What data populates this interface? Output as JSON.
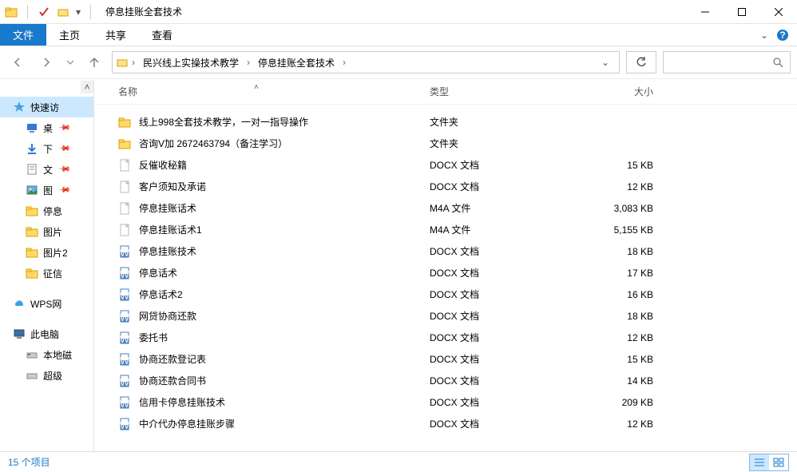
{
  "window": {
    "title": "停息挂账全套技术",
    "tabs": {
      "file": "文件",
      "home": "主页",
      "share": "共享",
      "view": "查看"
    }
  },
  "breadcrumb": {
    "segments": [
      "民兴线上实操技术教学",
      "停息挂账全套技术"
    ]
  },
  "columns": {
    "name": "名称",
    "type": "类型",
    "size": "大小"
  },
  "sidebar": {
    "quick": "快速访",
    "items": [
      {
        "label": "桌",
        "pinned": true,
        "icon": "desktop"
      },
      {
        "label": "下",
        "pinned": true,
        "icon": "download"
      },
      {
        "label": "文",
        "pinned": true,
        "icon": "document"
      },
      {
        "label": "图",
        "pinned": true,
        "icon": "picture"
      },
      {
        "label": "停息",
        "pinned": false,
        "icon": "folder"
      },
      {
        "label": "图片",
        "pinned": false,
        "icon": "folder"
      },
      {
        "label": "图片2",
        "pinned": false,
        "icon": "folder"
      },
      {
        "label": "征信",
        "pinned": false,
        "icon": "folder"
      }
    ],
    "wps": "WPS网",
    "thispc": "此电脑",
    "localdisk": "本地磁",
    "super": "超级"
  },
  "files": [
    {
      "name": "线上998全套技术教学，一对一指导操作",
      "type": "文件夹",
      "size": "",
      "icon": "folder"
    },
    {
      "name": "咨询V加  2672463794（备注学习）",
      "type": "文件夹",
      "size": "",
      "icon": "folder"
    },
    {
      "name": "反催收秘籍",
      "type": "DOCX 文档",
      "size": "15 KB",
      "icon": "docx-blank"
    },
    {
      "name": "客户须知及承诺",
      "type": "DOCX 文档",
      "size": "12 KB",
      "icon": "docx-blank"
    },
    {
      "name": "停息挂账话术",
      "type": "M4A 文件",
      "size": "3,083 KB",
      "icon": "blank"
    },
    {
      "name": "停息挂账话术1",
      "type": "M4A 文件",
      "size": "5,155 KB",
      "icon": "blank"
    },
    {
      "name": "停息挂账技术",
      "type": "DOCX 文档",
      "size": "18 KB",
      "icon": "docx"
    },
    {
      "name": "停息话术",
      "type": "DOCX 文档",
      "size": "17 KB",
      "icon": "docx"
    },
    {
      "name": "停息话术2",
      "type": "DOCX 文档",
      "size": "16 KB",
      "icon": "docx"
    },
    {
      "name": "网贷协商还款",
      "type": "DOCX 文档",
      "size": "18 KB",
      "icon": "docx"
    },
    {
      "name": "委托书",
      "type": "DOCX 文档",
      "size": "12 KB",
      "icon": "docx"
    },
    {
      "name": "协商还款登记表",
      "type": "DOCX 文档",
      "size": "15 KB",
      "icon": "docx"
    },
    {
      "name": "协商还款合同书",
      "type": "DOCX 文档",
      "size": "14 KB",
      "icon": "docx"
    },
    {
      "name": "信用卡停息挂账技术",
      "type": "DOCX 文档",
      "size": "209 KB",
      "icon": "docx"
    },
    {
      "name": "中介代办停息挂账步骤",
      "type": "DOCX 文档",
      "size": "12 KB",
      "icon": "docx"
    }
  ],
  "status": {
    "count": "15 个项目"
  }
}
